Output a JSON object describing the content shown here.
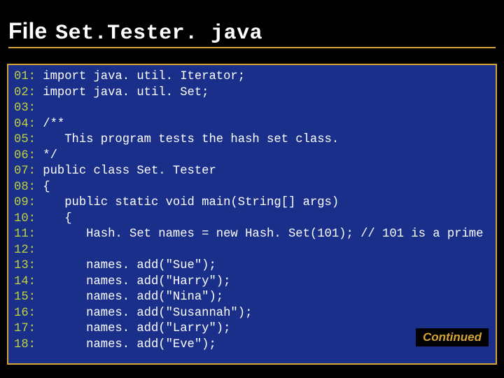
{
  "title": {
    "label": "File",
    "filename": "Set.Tester. java"
  },
  "continued_label": "Continued",
  "lines": [
    {
      "n": "01:",
      "code": " import java. util. Iterator;"
    },
    {
      "n": "02:",
      "code": " import java. util. Set;"
    },
    {
      "n": "03:",
      "code": ""
    },
    {
      "n": "04:",
      "code": " /**"
    },
    {
      "n": "05:",
      "code": "    This program tests the hash set class."
    },
    {
      "n": "06:",
      "code": " */"
    },
    {
      "n": "07:",
      "code": " public class Set. Tester"
    },
    {
      "n": "08:",
      "code": " {"
    },
    {
      "n": "09:",
      "code": "    public static void main(String[] args)"
    },
    {
      "n": "10:",
      "code": "    {"
    },
    {
      "n": "11:",
      "code": "       Hash. Set names = new Hash. Set(101); // 101 is a prime"
    },
    {
      "n": "12:",
      "code": ""
    },
    {
      "n": "13:",
      "code": "       names. add(\"Sue\");"
    },
    {
      "n": "14:",
      "code": "       names. add(\"Harry\");"
    },
    {
      "n": "15:",
      "code": "       names. add(\"Nina\");"
    },
    {
      "n": "16:",
      "code": "       names. add(\"Susannah\");"
    },
    {
      "n": "17:",
      "code": "       names. add(\"Larry\");"
    },
    {
      "n": "18:",
      "code": "       names. add(\"Eve\");"
    }
  ]
}
